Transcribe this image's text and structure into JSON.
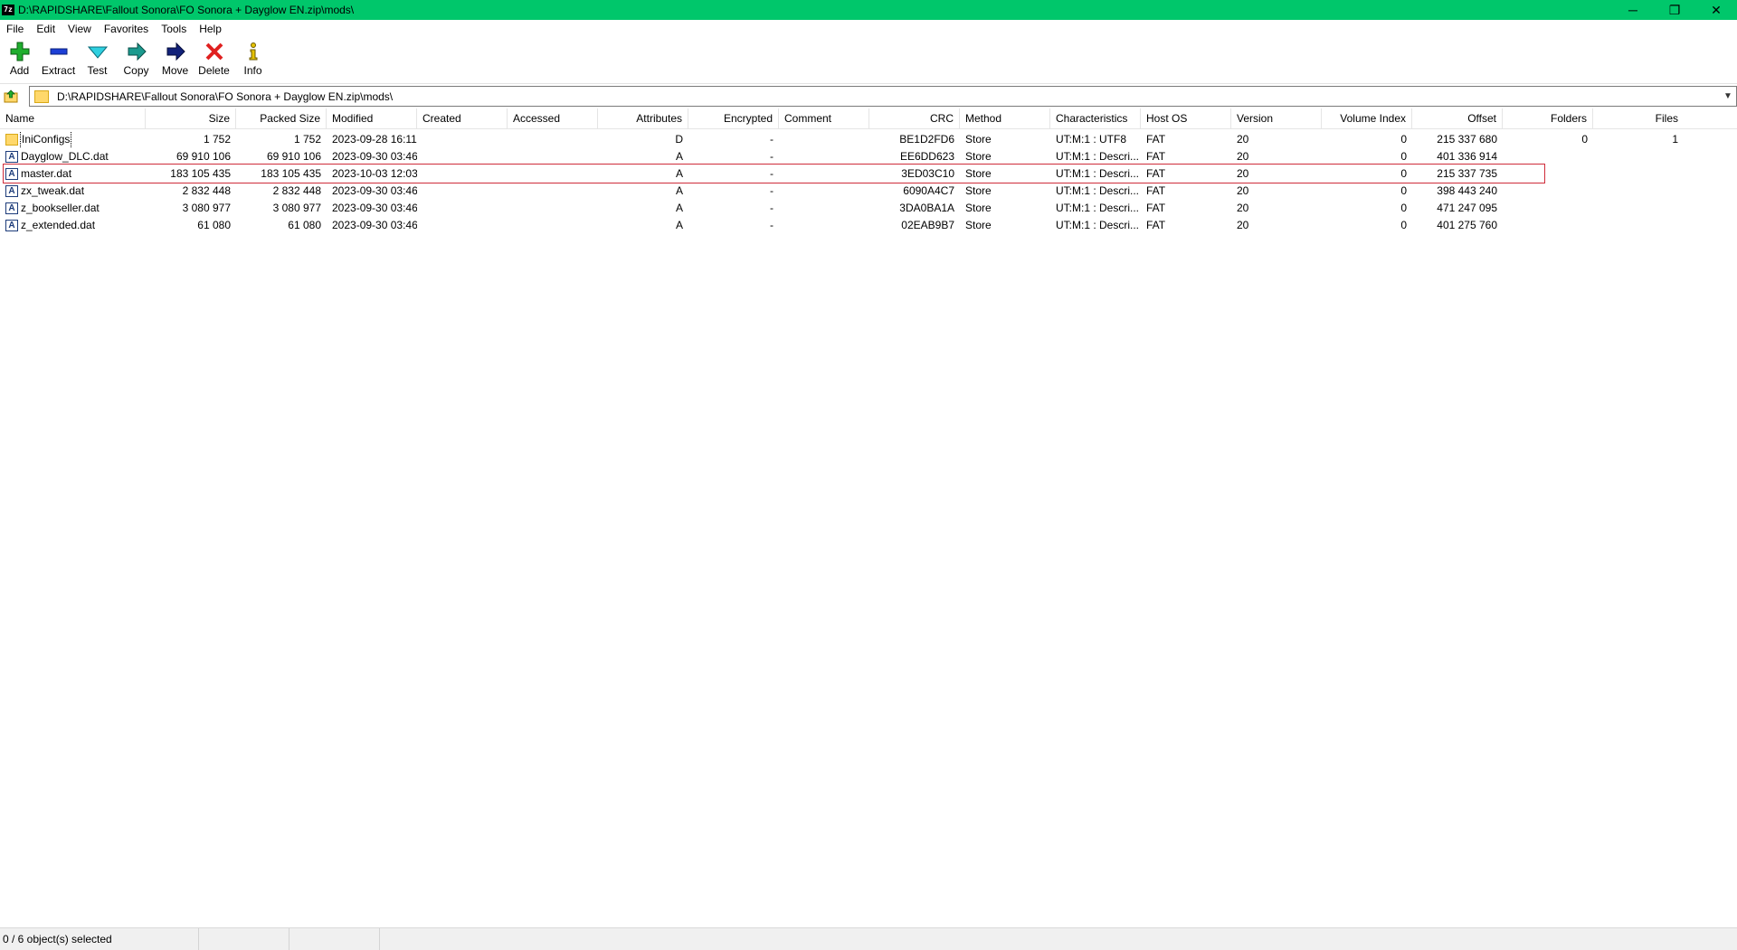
{
  "window": {
    "app_icon_text": "7z",
    "title": "D:\\RAPIDSHARE\\Fallout Sonora\\FO Sonora + Dayglow EN.zip\\mods\\",
    "minimize": "─",
    "restore": "❐",
    "close": "✕"
  },
  "menu": [
    "File",
    "Edit",
    "View",
    "Favorites",
    "Tools",
    "Help"
  ],
  "toolbar": {
    "add": "Add",
    "extract": "Extract",
    "test": "Test",
    "copy": "Copy",
    "move": "Move",
    "delete": "Delete",
    "info": "Info"
  },
  "address": {
    "path": "D:\\RAPIDSHARE\\Fallout Sonora\\FO Sonora + Dayglow EN.zip\\mods\\"
  },
  "columns": {
    "name": "Name",
    "size": "Size",
    "packed": "Packed Size",
    "modified": "Modified",
    "created": "Created",
    "accessed": "Accessed",
    "attributes": "Attributes",
    "encrypted": "Encrypted",
    "comment": "Comment",
    "crc": "CRC",
    "method": "Method",
    "characteristics": "Characteristics",
    "hostos": "Host OS",
    "version": "Version",
    "volindex": "Volume Index",
    "offset": "Offset",
    "folders": "Folders",
    "files": "Files"
  },
  "rows": [
    {
      "name": "IniConfigs",
      "size": "1 752",
      "packed": "1 752",
      "modified": "2023-09-28 16:11",
      "attributes": "D",
      "encrypted": "-",
      "crc": "BE1D2FD6",
      "method": "Store",
      "characteristics": "UT:M:1 : UTF8",
      "hostos": "FAT",
      "version": "20",
      "volindex": "0",
      "offset": "215 337 680",
      "folders": "0",
      "files": "1"
    },
    {
      "name": "Dayglow_DLC.dat",
      "size": "69 910 106",
      "packed": "69 910 106",
      "modified": "2023-09-30 03:46",
      "attributes": "A",
      "encrypted": "-",
      "crc": "EE6DD623",
      "method": "Store",
      "characteristics": "UT:M:1 : Descri...",
      "hostos": "FAT",
      "version": "20",
      "volindex": "0",
      "offset": "401 336 914",
      "folders": "",
      "files": ""
    },
    {
      "name": "master.dat",
      "size": "183 105 435",
      "packed": "183 105 435",
      "modified": "2023-10-03 12:03",
      "attributes": "A",
      "encrypted": "-",
      "crc": "3ED03C10",
      "method": "Store",
      "characteristics": "UT:M:1 : Descri...",
      "hostos": "FAT",
      "version": "20",
      "volindex": "0",
      "offset": "215 337 735",
      "folders": "",
      "files": ""
    },
    {
      "name": "zx_tweak.dat",
      "size": "2 832 448",
      "packed": "2 832 448",
      "modified": "2023-09-30 03:46",
      "attributes": "A",
      "encrypted": "-",
      "crc": "6090A4C7",
      "method": "Store",
      "characteristics": "UT:M:1 : Descri...",
      "hostos": "FAT",
      "version": "20",
      "volindex": "0",
      "offset": "398 443 240",
      "folders": "",
      "files": ""
    },
    {
      "name": "z_bookseller.dat",
      "size": "3 080 977",
      "packed": "3 080 977",
      "modified": "2023-09-30 03:46",
      "attributes": "A",
      "encrypted": "-",
      "crc": "3DA0BA1A",
      "method": "Store",
      "characteristics": "UT:M:1 : Descri...",
      "hostos": "FAT",
      "version": "20",
      "volindex": "0",
      "offset": "471 247 095",
      "folders": "",
      "files": ""
    },
    {
      "name": "z_extended.dat",
      "size": "61 080",
      "packed": "61 080",
      "modified": "2023-09-30 03:46",
      "attributes": "A",
      "encrypted": "-",
      "crc": "02EAB9B7",
      "method": "Store",
      "characteristics": "UT:M:1 : Descri...",
      "hostos": "FAT",
      "version": "20",
      "volindex": "0",
      "offset": "401 275 760",
      "folders": "",
      "files": ""
    }
  ],
  "status": {
    "selection": "0 / 6 object(s) selected"
  }
}
